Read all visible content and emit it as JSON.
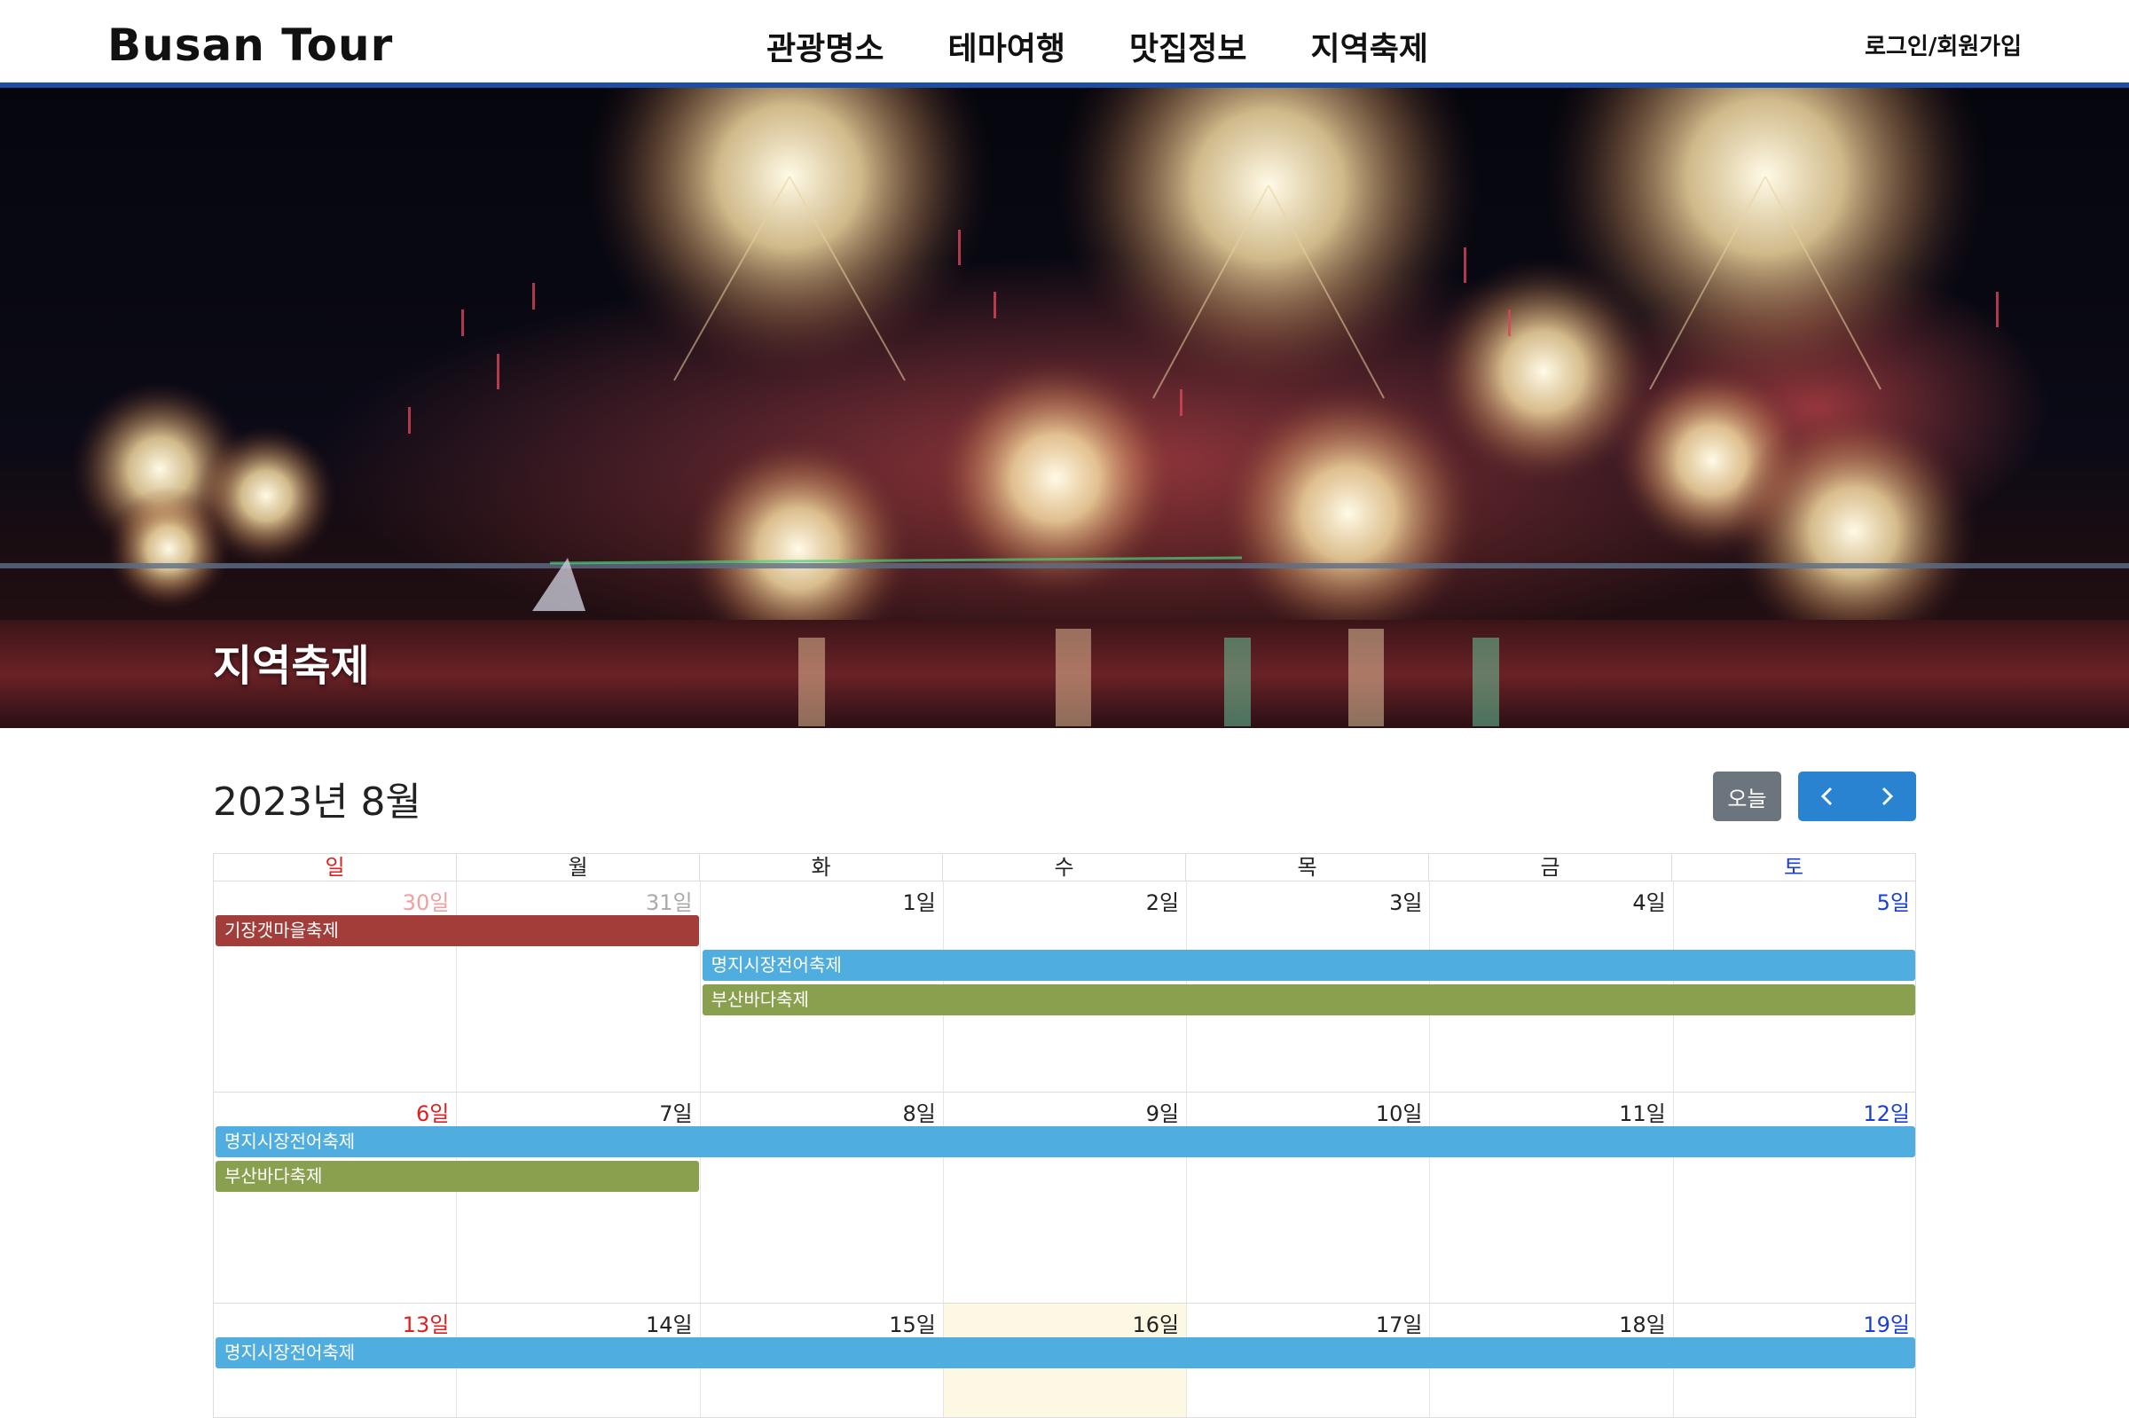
{
  "header": {
    "logo": "Busan Tour",
    "nav": [
      "관광명소",
      "테마여행",
      "맛집정보",
      "지역축제"
    ],
    "login": "로그인/회원가입"
  },
  "hero": {
    "title": "지역축제"
  },
  "calendar": {
    "title": "2023년 8월",
    "today_label": "오늘",
    "prev_icon": "chevron-left-icon",
    "next_icon": "chevron-right-icon",
    "dow": [
      "일",
      "월",
      "화",
      "수",
      "목",
      "금",
      "토"
    ],
    "weeks": [
      {
        "days": [
          "30일",
          "31일",
          "1일",
          "2일",
          "3일",
          "4일",
          "5일"
        ],
        "events": [
          {
            "label": "기장갯마을축제",
            "color": "#a23d3a"
          },
          {
            "label": "명지시장전어축제",
            "color": "#4fade0"
          },
          {
            "label": "부산바다축제",
            "color": "#89a14e"
          }
        ]
      },
      {
        "days": [
          "6일",
          "7일",
          "8일",
          "9일",
          "10일",
          "11일",
          "12일"
        ],
        "events": [
          {
            "label": "명지시장전어축제",
            "color": "#4fade0"
          },
          {
            "label": "부산바다축제",
            "color": "#89a14e"
          }
        ]
      },
      {
        "days": [
          "13일",
          "14일",
          "15일",
          "16일",
          "17일",
          "18일",
          "19일"
        ],
        "events": [
          {
            "label": "명지시장전어축제",
            "color": "#4fade0"
          }
        ]
      }
    ],
    "colors": {
      "sunday": "#e02020",
      "saturday": "#1a3fd1",
      "muted_sunday": "#f0a0a0",
      "muted": "#aaaaaa",
      "today_bg": "#fcf8e3"
    }
  }
}
